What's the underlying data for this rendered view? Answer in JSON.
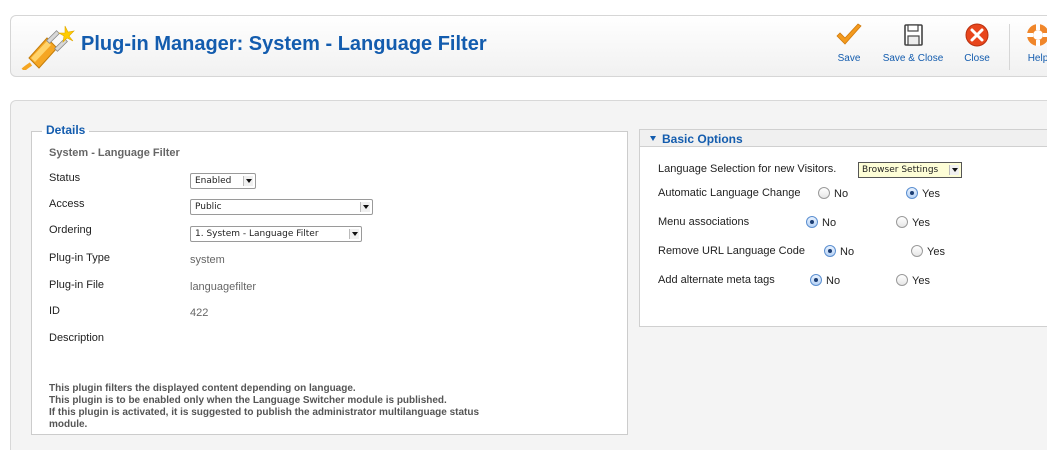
{
  "header": {
    "title": "Plug-in Manager: System - Language Filter",
    "icon": "plug-icon",
    "toolbar": {
      "save_label": "Save",
      "save_close_label": "Save & Close",
      "close_label": "Close",
      "help_label": "Help"
    }
  },
  "details": {
    "legend": "Details",
    "subtitle": "System - Language Filter",
    "status_label": "Status",
    "status_value": "Enabled",
    "access_label": "Access",
    "access_value": "Public",
    "ordering_label": "Ordering",
    "ordering_value": "1. System - Language Filter",
    "type_label": "Plug-in Type",
    "type_value": "system",
    "file_label": "Plug-in File",
    "file_value": "languagefilter",
    "id_label": "ID",
    "id_value": "422",
    "description_label": "Description",
    "description_lines": [
      "This plugin filters the displayed content depending on language.",
      "This plugin is to be enabled only when the Language Switcher module is published.",
      "If this plugin is activated, it is suggested to publish the administrator multilanguage status",
      "module."
    ]
  },
  "options": {
    "title": "Basic Options",
    "language_selection_label": "Language Selection for new Visitors.",
    "language_selection_value": "Browser Settings",
    "auto_change_label": "Automatic Language Change",
    "auto_change_no": "No",
    "auto_change_yes": "Yes",
    "menu_assoc_label": "Menu associations",
    "menu_assoc_no": "No",
    "menu_assoc_yes": "Yes",
    "remove_url_label": "Remove URL Language Code",
    "remove_url_no": "No",
    "remove_url_yes": "Yes",
    "alt_meta_label": "Add alternate meta tags",
    "alt_meta_no": "No",
    "alt_meta_yes": "Yes"
  },
  "colors": {
    "accent": "#135cae",
    "save_check": "#f39a1e",
    "close_red": "#e8461d",
    "help_orange": "#f0862a"
  }
}
